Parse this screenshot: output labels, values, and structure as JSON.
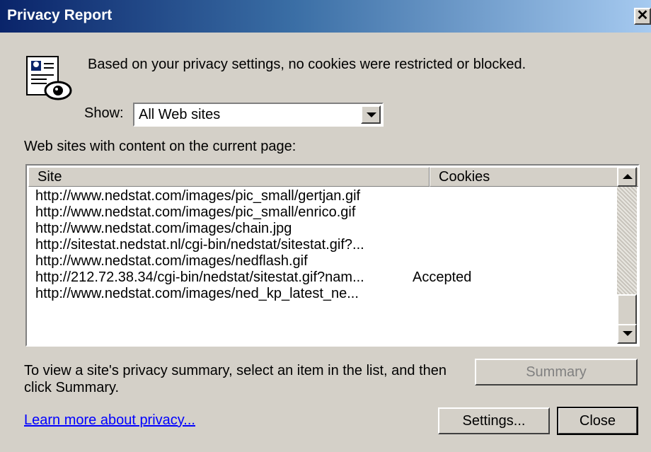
{
  "window": {
    "title": "Privacy Report",
    "close_glyph": "✕"
  },
  "message": "Based on your privacy settings, no cookies were restricted or blocked.",
  "show": {
    "label": "Show:",
    "selected": "All Web sites"
  },
  "list": {
    "label": "Web sites with content on the current page:",
    "columns": [
      "Site",
      "Cookies"
    ],
    "rows": [
      {
        "site": "http://www.nedstat.com/images/pic_small/gertjan.gif",
        "cookies": ""
      },
      {
        "site": "http://www.nedstat.com/images/pic_small/enrico.gif",
        "cookies": ""
      },
      {
        "site": "http://www.nedstat.com/images/chain.jpg",
        "cookies": ""
      },
      {
        "site": "http://sitestat.nedstat.nl/cgi-bin/nedstat/sitestat.gif?...",
        "cookies": ""
      },
      {
        "site": "http://www.nedstat.com/images/nedflash.gif",
        "cookies": ""
      },
      {
        "site": "http://212.72.38.34/cgi-bin/nedstat/sitestat.gif?nam...",
        "cookies": "Accepted"
      },
      {
        "site": "http://www.nedstat.com/images/ned_kp_latest_ne...",
        "cookies": ""
      }
    ]
  },
  "instructions": "To view a site's privacy summary, select an item in the list, and then click Summary.",
  "buttons": {
    "summary": "Summary",
    "settings": "Settings...",
    "close": "Close"
  },
  "link": "Learn more about privacy...",
  "icons": {
    "privacy_report": "privacy-report-icon",
    "dropdown": "chevron-down-icon"
  }
}
